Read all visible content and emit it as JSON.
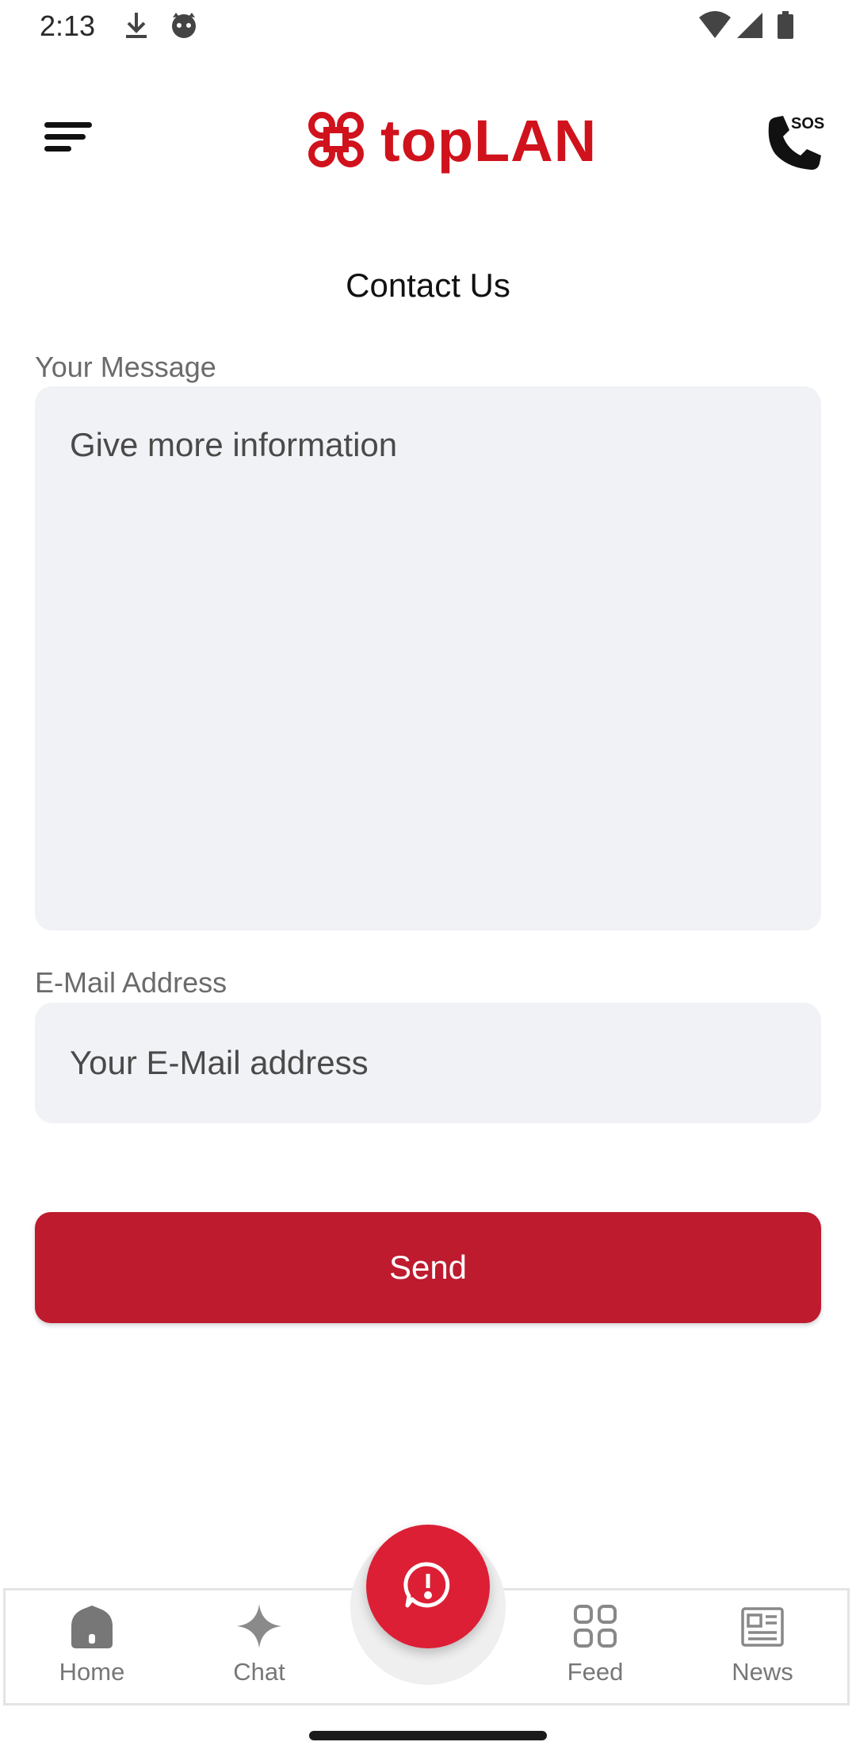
{
  "status_bar": {
    "time": "2:13",
    "left_icons": [
      "download-icon",
      "cat-notification-icon"
    ],
    "right_icons": [
      "wifi-icon",
      "signal-icon",
      "battery-icon"
    ]
  },
  "header": {
    "menu_icon": "menu-icon",
    "brand_name": "topLAN",
    "brand_color": "#d0121d",
    "sos_label": "SOS",
    "sos_icon": "phone-sos-icon"
  },
  "page": {
    "title": "Contact Us"
  },
  "form": {
    "message_label": "Your Message",
    "message_placeholder": "Give more information",
    "message_value": "",
    "email_label": "E-Mail Address",
    "email_placeholder": "Your E-Mail address",
    "email_value": "",
    "send_label": "Send",
    "send_color": "#be1b2f"
  },
  "bottom_nav": {
    "items": [
      {
        "label": "Home",
        "icon": "home-icon"
      },
      {
        "label": "Chat",
        "icon": "sparkle-icon"
      },
      {
        "label": "Feed",
        "icon": "grid-icon"
      },
      {
        "label": "News",
        "icon": "newspaper-icon"
      }
    ],
    "fab_icon": "alert-chat-icon",
    "fab_color": "#dc1f35"
  }
}
